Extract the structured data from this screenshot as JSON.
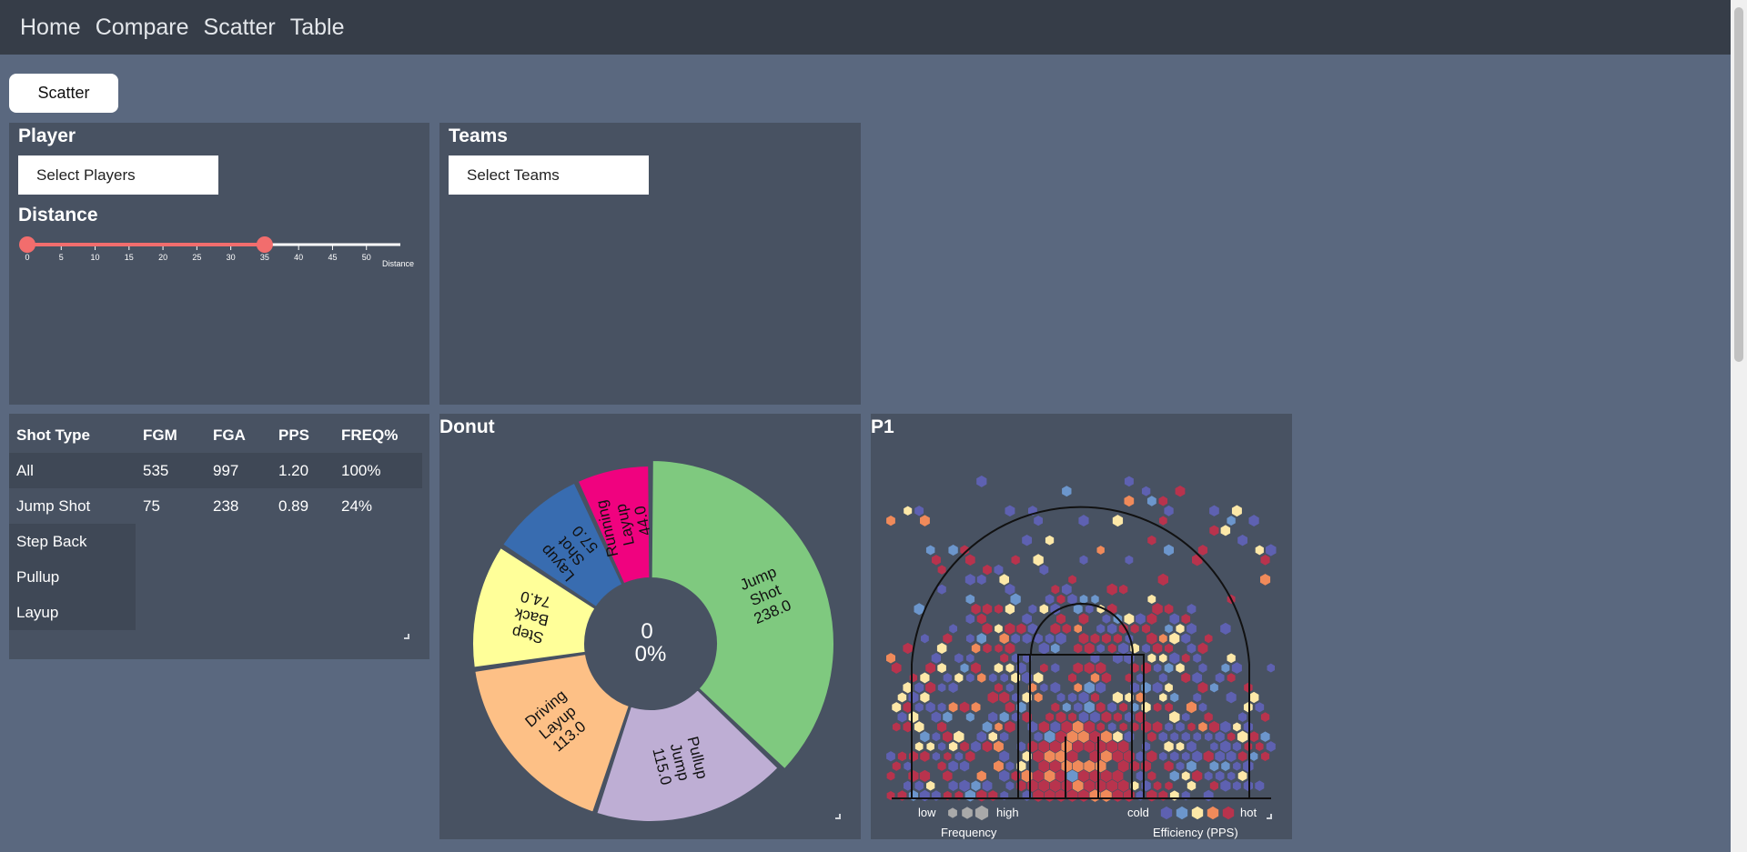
{
  "nav": {
    "items": [
      {
        "label": "Home"
      },
      {
        "label": "Compare"
      },
      {
        "label": "Scatter"
      },
      {
        "label": "Table"
      }
    ]
  },
  "page_button": {
    "label": "Scatter"
  },
  "player_panel": {
    "title": "Player",
    "select_label": "Select Players",
    "distance_title": "Distance",
    "slider": {
      "min": 0,
      "max": 55,
      "low": 0,
      "high": 35,
      "ticks": [
        "0",
        "5",
        "10",
        "15",
        "20",
        "25",
        "30",
        "35",
        "40",
        "45",
        "50"
      ],
      "axis_label": "Distance",
      "color": "#f26d6d"
    }
  },
  "teams_panel": {
    "title": "Teams",
    "select_label": "Select Teams"
  },
  "shot_table": {
    "headers": [
      "Shot Type",
      "FGM",
      "FGA",
      "PPS",
      "FREQ%"
    ],
    "rows": [
      [
        "All",
        "535",
        "997",
        "1.20",
        "100%"
      ],
      [
        "Jump Shot",
        "75",
        "238",
        "0.89",
        "24%"
      ],
      [
        "Step Back",
        "",
        "",
        "",
        ""
      ],
      [
        "Pullup",
        "",
        "",
        "",
        ""
      ],
      [
        "Layup",
        "",
        "",
        "",
        ""
      ]
    ]
  },
  "donut": {
    "title": "Donut",
    "center_count": "0",
    "center_pct": "0%",
    "slices": [
      {
        "label": [
          "Jump",
          "Shot",
          "238.0"
        ],
        "value": 238,
        "color": "#7fc97f"
      },
      {
        "label": [
          "Pullup",
          "Jump",
          "115.0"
        ],
        "value": 115,
        "color": "#beaed4"
      },
      {
        "label": [
          "Driving",
          "Layup",
          "113.0"
        ],
        "value": 113,
        "color": "#fdc086"
      },
      {
        "label": [
          "Step",
          "Back",
          "74.0"
        ],
        "value": 74,
        "color": "#ffff99"
      },
      {
        "label": [
          "Layup",
          "Shot",
          "57.0"
        ],
        "value": 57,
        "color": "#386cb0"
      },
      {
        "label": [
          "Running",
          "Layup",
          "44.0"
        ],
        "value": 44,
        "color": "#f0027f"
      }
    ]
  },
  "shot_chart": {
    "title": "P1",
    "legend": {
      "low": "low",
      "high": "high",
      "frequency": "Frequency",
      "cold": "cold",
      "hot": "hot",
      "efficiency": "Efficiency (PPS)",
      "freq_color": "#a9a9a9",
      "eff_colors": [
        "#5e61b1",
        "#6c96cc",
        "#fde8a8",
        "#f08a5a",
        "#b8334d"
      ]
    }
  }
}
